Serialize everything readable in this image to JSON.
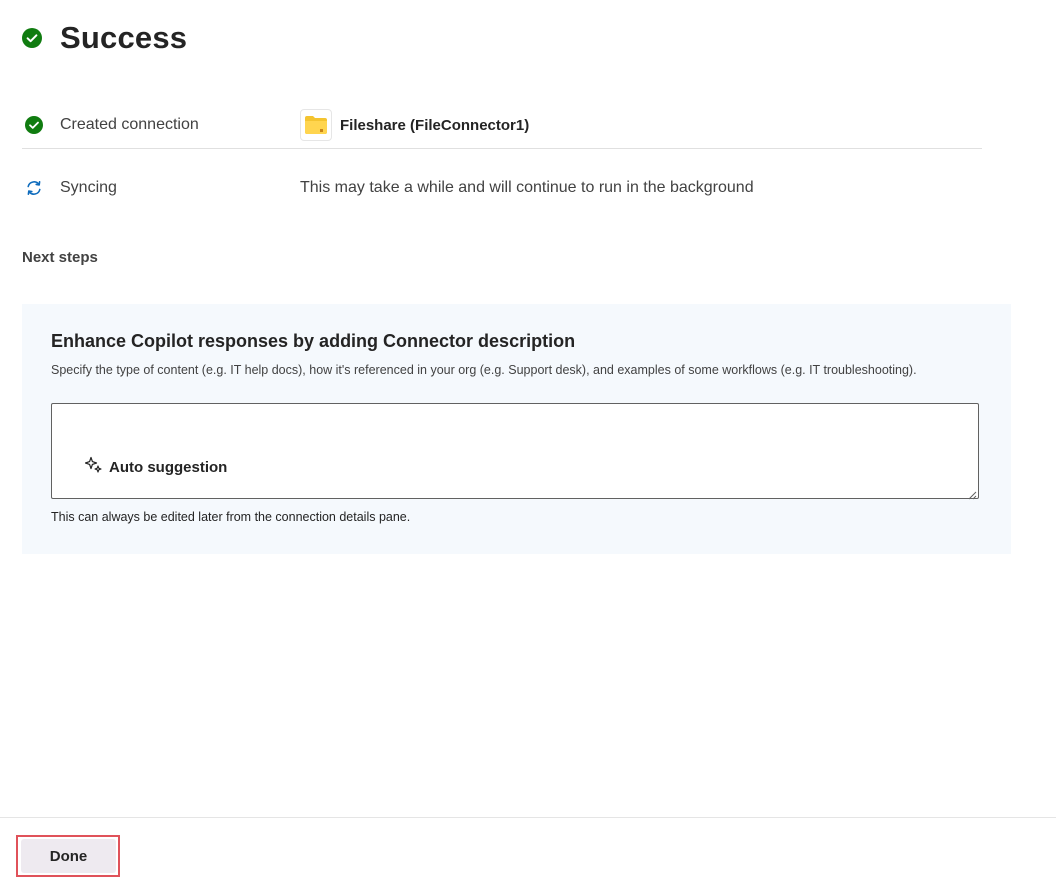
{
  "header": {
    "title": "Success",
    "icon": "check-circle-icon",
    "icon_color": "#107c10"
  },
  "status_rows": [
    {
      "icon": "check-circle-icon",
      "label": "Created connection",
      "connection_icon": "folder-icon",
      "connection_name": "Fileshare (FileConnector1)"
    },
    {
      "icon": "sync-icon",
      "label": "Syncing",
      "value": "This may take a while and will continue to run in the background"
    }
  ],
  "next_steps": {
    "heading": "Next steps"
  },
  "card": {
    "title": "Enhance Copilot responses by adding Connector description",
    "description": "Specify the type of content (e.g. IT help docs), how it's referenced in your org (e.g. Support desk), and examples of some workflows (e.g. IT troubleshooting).",
    "textarea_value": "",
    "auto_suggest_label": "Auto suggestion",
    "auto_suggest_icon": "sparkle-icon",
    "hint": "This can always be edited later from the connection details pane."
  },
  "footer": {
    "done_label": "Done"
  },
  "colors": {
    "success": "#107c10",
    "sync": "#0f6cbd",
    "card_bg": "#f5f9fd",
    "highlight": "#e0525a",
    "folder": "#f4c430"
  }
}
